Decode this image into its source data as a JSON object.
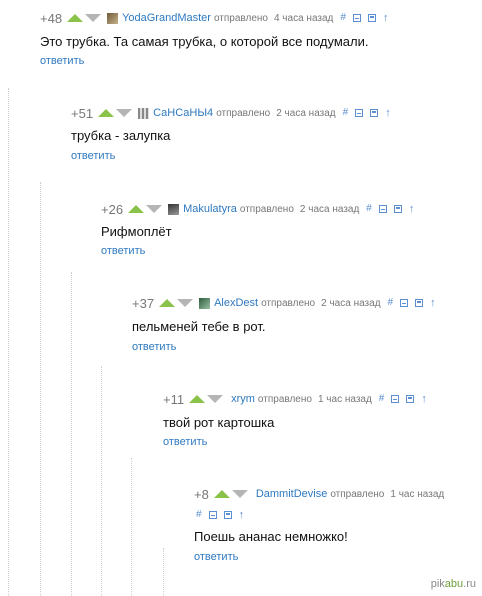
{
  "comments": [
    {
      "rating": "+48",
      "author": "YodaGrandMaster",
      "meta": "отправлено",
      "time": "4 часа назад",
      "text": "Это трубка. Та самая трубка, о которой все подумали.",
      "reply": "ответить"
    },
    {
      "rating": "+51",
      "author": "СаНСаНЫ4",
      "meta": "отправлено",
      "time": "2 часа назад",
      "text": "трубка - залупка",
      "reply": "ответить"
    },
    {
      "rating": "+26",
      "author": "Makulatyra",
      "meta": "отправлено",
      "time": "2 часа назад",
      "text": "Рифмоплёт",
      "reply": "ответить"
    },
    {
      "rating": "+37",
      "author": "AlexDest",
      "meta": "отправлено",
      "time": "2 часа назад",
      "text": "пельменей тебе в рот.",
      "reply": "ответить"
    },
    {
      "rating": "+11",
      "author": "xrym",
      "meta": "отправлено",
      "time": "1 час назад",
      "text": "твой рот картошка",
      "reply": "ответить"
    },
    {
      "rating": "+8",
      "author": "DammitDevise",
      "meta": "отправлено",
      "time": "1 час назад",
      "text": "Поешь ананас немножко!",
      "reply": "ответить"
    }
  ],
  "icons": {
    "hash": "#",
    "up_arrow": "↑"
  },
  "watermark": {
    "pre": "pik",
    "accent": "abu",
    "post": ".ru"
  },
  "colors": {
    "link": "#2e79c1",
    "vote_up": "#8bc34a",
    "vote_down": "#b5b5b5",
    "icon": "#5b8fd1"
  }
}
